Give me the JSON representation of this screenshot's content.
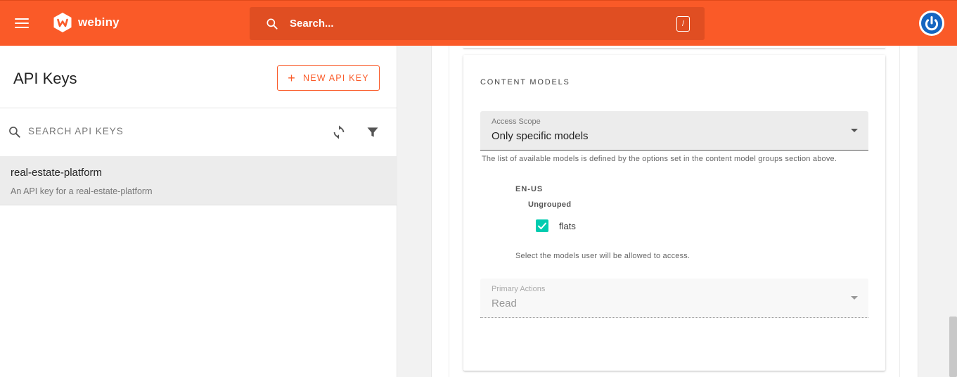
{
  "topbar": {
    "brand": "webiny",
    "search_placeholder": "Search...",
    "search_shortcut": "/",
    "brand_color": "#fa5a28"
  },
  "sidebar": {
    "title": "API Keys",
    "new_button_label": "NEW API KEY",
    "search_placeholder": "SEARCH API KEYS",
    "items": [
      {
        "title": "real-estate-platform",
        "description": "An API key for a real-estate-platform"
      }
    ]
  },
  "content_models": {
    "section_title": "CONTENT MODELS",
    "access_scope": {
      "label": "Access Scope",
      "value": "Only specific models",
      "helper": "The list of available models is defined by the options set in the content model groups section above."
    },
    "locale": "EN-US",
    "group": "Ungrouped",
    "models": [
      {
        "label": "flats",
        "checked": true
      }
    ],
    "models_helper": "Select the models user will be allowed to access.",
    "primary_actions": {
      "label": "Primary Actions",
      "value": "Read"
    },
    "check_color": "#00ccb0"
  }
}
